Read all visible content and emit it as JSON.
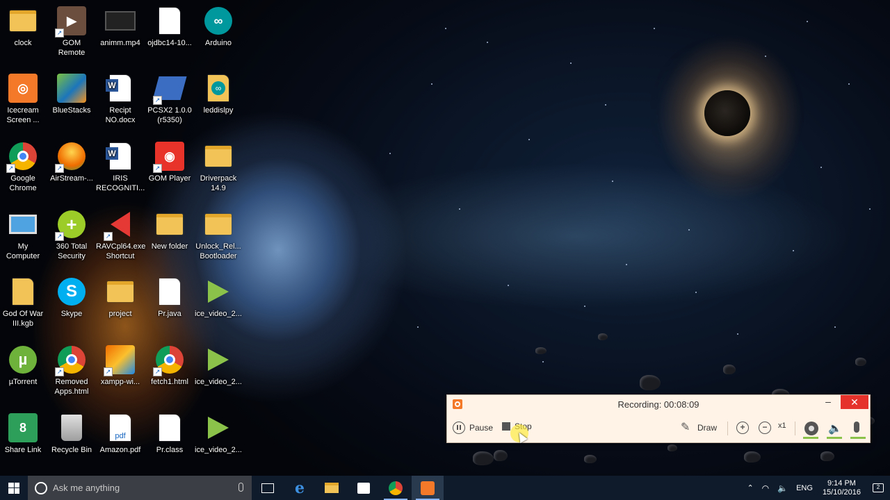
{
  "desktop": {
    "icons": [
      {
        "label": "clock",
        "icon": "folder-icon"
      },
      {
        "label": "GOM\nRemote",
        "icon": "gom-remote-icon"
      },
      {
        "label": "animm.mp4",
        "icon": "video-file-icon"
      },
      {
        "label": "ojdbc14-10...",
        "icon": "file-icon"
      },
      {
        "label": "Arduino",
        "icon": "arduino-icon"
      },
      {
        "label": "Icecream\nScreen ...",
        "icon": "icecream-icon"
      },
      {
        "label": "BlueStacks",
        "icon": "bluestacks-icon"
      },
      {
        "label": "Recipt\nNO.docx",
        "icon": "word-doc-icon"
      },
      {
        "label": "PCSX2 1.0.0\n(r5350)",
        "icon": "pcsx2-icon"
      },
      {
        "label": "leddislpy",
        "icon": "arduino-sketch-icon"
      },
      {
        "label": "Google\nChrome",
        "icon": "chrome-icon"
      },
      {
        "label": "AirStream-...",
        "icon": "airstream-icon"
      },
      {
        "label": "IRIS\nRECOGNITI...",
        "icon": "word-doc-icon"
      },
      {
        "label": "GOM Player",
        "icon": "gom-player-icon"
      },
      {
        "label": "Driverpack\n14.9",
        "icon": "folder-icon"
      },
      {
        "label": "My\nComputer",
        "icon": "computer-icon"
      },
      {
        "label": "360 Total\nSecurity",
        "icon": "security-icon"
      },
      {
        "label": "RAVCpl64.exe\nShortcut",
        "icon": "speaker-icon"
      },
      {
        "label": "New folder",
        "icon": "folder-icon"
      },
      {
        "label": "Unlock_Rel...\nBootloader",
        "icon": "folder-icon"
      },
      {
        "label": "God Of War\nIII.kgb",
        "icon": "archive-icon"
      },
      {
        "label": "Skype",
        "icon": "skype-icon"
      },
      {
        "label": "project",
        "icon": "folder-icon"
      },
      {
        "label": "Pr.java",
        "icon": "file-icon"
      },
      {
        "label": "ice_video_2...",
        "icon": "webm-icon"
      },
      {
        "label": "µTorrent",
        "icon": "utorrent-icon"
      },
      {
        "label": "Removed\nApps.html",
        "icon": "chrome-icon"
      },
      {
        "label": "xampp-wi...",
        "icon": "installer-icon"
      },
      {
        "label": "fetch1.html",
        "icon": "chrome-icon"
      },
      {
        "label": "ice_video_2...",
        "icon": "webm-icon"
      },
      {
        "label": "Share Link",
        "icon": "sharelink-icon"
      },
      {
        "label": "Recycle Bin",
        "icon": "recycle-bin-icon"
      },
      {
        "label": "Amazon.pdf",
        "icon": "pdf-icon"
      },
      {
        "label": "Pr.class",
        "icon": "file-icon"
      },
      {
        "label": "ice_video_2...",
        "icon": "webm-icon"
      }
    ]
  },
  "recorder": {
    "title": "Recording:  00:08:09",
    "pause_label": "Pause",
    "stop_label": "Stop",
    "draw_label": "Draw",
    "zoom_level": "x1",
    "minimize_glyph": "–",
    "close_glyph": "✕"
  },
  "taskbar": {
    "search_placeholder": "Ask me anything",
    "apps": [
      "task-view-icon",
      "edge-icon",
      "file-explorer-icon",
      "store-icon",
      "chrome-icon",
      "icecream-recorder-icon"
    ],
    "tray": {
      "language": "ENG",
      "time": "9:14 PM",
      "date": "15/10/2016",
      "notifications": "2"
    }
  },
  "colors": {
    "recorder_bg": "#fff2e6",
    "close_red": "#e5322a",
    "taskbar": "#0f1b2a",
    "level_green": "#8bc34a"
  }
}
